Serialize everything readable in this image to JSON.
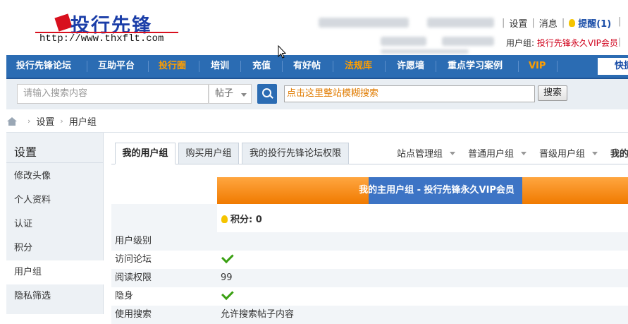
{
  "header": {
    "logo_text": "投行先锋",
    "logo_url": "http://www.thxflt.com",
    "links": {
      "settings": "设置",
      "messages": "消息",
      "remind": "提醒(1)"
    },
    "usergroup_label": "用户组: ",
    "usergroup_value": "投行先锋永久VIP会员"
  },
  "nav": {
    "items": [
      {
        "label": "投行先锋论坛",
        "highlight": false
      },
      {
        "label": "互助平台",
        "highlight": false
      },
      {
        "label": "投行圈",
        "highlight": true
      },
      {
        "label": "培训",
        "highlight": false
      },
      {
        "label": "充值",
        "highlight": false
      },
      {
        "label": "有好帖",
        "highlight": false
      },
      {
        "label": "法规库",
        "highlight": true
      },
      {
        "label": "许愿墙",
        "highlight": false
      },
      {
        "label": "重点学习案例",
        "highlight": false
      },
      {
        "label": "VIP",
        "highlight": true
      }
    ],
    "quick_label": "快捷"
  },
  "search": {
    "placeholder": "请输入搜索内容",
    "type_label": "帖子",
    "fuzzy_text": "点击这里整站模糊搜索",
    "fuzzy_button": "搜索"
  },
  "breadcrumb": {
    "items": [
      "设置",
      "用户组"
    ]
  },
  "sidebar": {
    "title": "设置",
    "items": [
      {
        "label": "修改头像",
        "active": false
      },
      {
        "label": "个人资料",
        "active": false
      },
      {
        "label": "认证",
        "active": false
      },
      {
        "label": "积分",
        "active": false
      },
      {
        "label": "用户组",
        "active": true
      },
      {
        "label": "隐私筛选",
        "active": false
      }
    ]
  },
  "tabs": {
    "left": [
      {
        "label": "我的用户组",
        "active": true
      },
      {
        "label": "购买用户组",
        "active": false
      },
      {
        "label": "我的投行先锋论坛权限",
        "active": false
      }
    ],
    "right": [
      "站点管理组",
      "普通用户组",
      "晋级用户组",
      "我的"
    ]
  },
  "group": {
    "banner_title": "我的主用户组 - 投行先锋永久VIP会员",
    "points_label": "积分: 0"
  },
  "permissions": [
    {
      "label": "用户级别",
      "value": "",
      "check": false
    },
    {
      "label": "访问论坛",
      "value": "",
      "check": true
    },
    {
      "label": "阅读权限",
      "value": "99",
      "check": false
    },
    {
      "label": "隐身",
      "value": "",
      "check": true
    },
    {
      "label": "使用搜索",
      "value": "允许搜索帖子内容",
      "check": false
    }
  ],
  "colors": {
    "nav_bg": "#2b6cb3",
    "nav_highlight": "#ff9e00",
    "accent_red": "#d0011b",
    "banner_orange": "#f07a00",
    "banner_blue": "#3d74c5",
    "check_green": "#3aa012"
  }
}
